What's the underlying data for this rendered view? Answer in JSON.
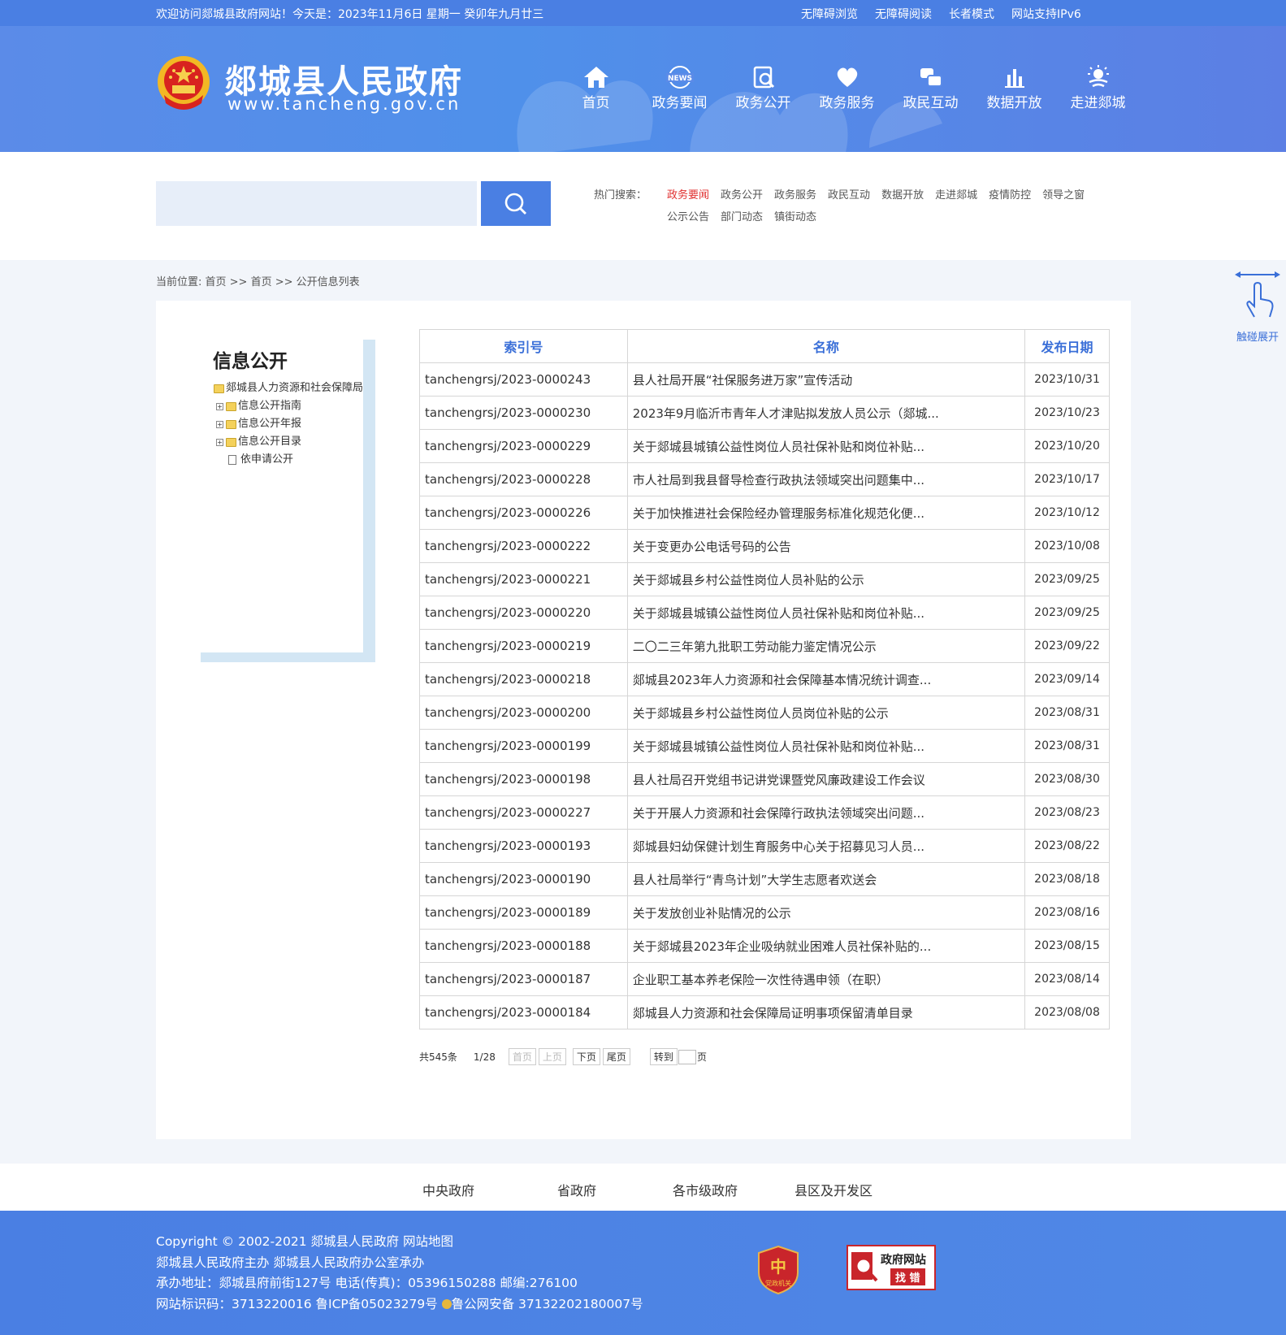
{
  "topbar": {
    "welcome": "欢迎访问郯城县政府网站！今天是：2023年11月6日  星期一  癸卯年九月廿三",
    "links": [
      "无障碍浏览",
      "无障碍阅读",
      "长者模式",
      "网站支持IPv6"
    ]
  },
  "header": {
    "title": "郯城县人民政府",
    "url": "www.tancheng.gov.cn",
    "nav": [
      {
        "label": "首页",
        "icon": "home-icon"
      },
      {
        "label": "政务要闻",
        "icon": "news-icon",
        "icon_text": "NEWS"
      },
      {
        "label": "政务公开",
        "icon": "document-search-icon"
      },
      {
        "label": "政务服务",
        "icon": "heart-hand-icon"
      },
      {
        "label": "政民互动",
        "icon": "chat-icon"
      },
      {
        "label": "数据开放",
        "icon": "bar-chart-icon"
      },
      {
        "label": "走进郯城",
        "icon": "weather-sun-icon"
      }
    ]
  },
  "search": {
    "placeholder": "",
    "hot_label": "热门搜索：",
    "hot_words": [
      "政务要闻",
      "政务公开",
      "政务服务",
      "政民互动",
      "数据开放",
      "走进郯城",
      "疫情防控",
      "领导之窗",
      "公示公告",
      "部门动态",
      "镇街动态"
    ]
  },
  "breadcrumb": {
    "prefix": "当前位置: ",
    "items": [
      "首页",
      "首页",
      "公开信息列表"
    ],
    "separator": " >> "
  },
  "sidebar": {
    "title": "信息公开",
    "root": "郯城县人力资源和社会保障局",
    "children": [
      "信息公开指南",
      "信息公开年报",
      "信息公开目录"
    ],
    "leaf": "依申请公开"
  },
  "table": {
    "headers": [
      "索引号",
      "名称",
      "发布日期"
    ],
    "rows": [
      [
        "tanchengrsj/2023-0000243",
        "县人社局开展“社保服务进万家”宣传活动",
        "2023/10/31"
      ],
      [
        "tanchengrsj/2023-0000230",
        "2023年9月临沂市青年人才津贴拟发放人员公示（郯城...",
        "2023/10/23"
      ],
      [
        "tanchengrsj/2023-0000229",
        "关于郯城县城镇公益性岗位人员社保补贴和岗位补贴...",
        "2023/10/20"
      ],
      [
        "tanchengrsj/2023-0000228",
        "市人社局到我县督导检查行政执法领域突出问题集中...",
        "2023/10/17"
      ],
      [
        "tanchengrsj/2023-0000226",
        "关于加快推进社会保险经办管理服务标准化规范化便...",
        "2023/10/12"
      ],
      [
        "tanchengrsj/2023-0000222",
        "关于变更办公电话号码的公告",
        "2023/10/08"
      ],
      [
        "tanchengrsj/2023-0000221",
        "关于郯城县乡村公益性岗位人员补贴的公示",
        "2023/09/25"
      ],
      [
        "tanchengrsj/2023-0000220",
        "关于郯城县城镇公益性岗位人员社保补贴和岗位补贴...",
        "2023/09/25"
      ],
      [
        "tanchengrsj/2023-0000219",
        "二〇二三年第九批职工劳动能力鉴定情况公示",
        "2023/09/22"
      ],
      [
        "tanchengrsj/2023-0000218",
        "郯城县2023年人力资源和社会保障基本情况统计调查...",
        "2023/09/14"
      ],
      [
        "tanchengrsj/2023-0000200",
        "关于郯城县乡村公益性岗位人员岗位补贴的公示",
        "2023/08/31"
      ],
      [
        "tanchengrsj/2023-0000199",
        "关于郯城县城镇公益性岗位人员社保补贴和岗位补贴...",
        "2023/08/31"
      ],
      [
        "tanchengrsj/2023-0000198",
        "县人社局召开党组书记讲党课暨党风廉政建设工作会议",
        "2023/08/30"
      ],
      [
        "tanchengrsj/2023-0000227",
        "关于开展人力资源和社会保障行政执法领域突出问题...",
        "2023/08/23"
      ],
      [
        "tanchengrsj/2023-0000193",
        "郯城县妇幼保健计划生育服务中心关于招募见习人员...",
        "2023/08/22"
      ],
      [
        "tanchengrsj/2023-0000190",
        "县人社局举行“青鸟计划”大学生志愿者欢送会",
        "2023/08/18"
      ],
      [
        "tanchengrsj/2023-0000189",
        "关于发放创业补贴情况的公示",
        "2023/08/16"
      ],
      [
        "tanchengrsj/2023-0000188",
        "关于郯城县2023年企业吸纳就业困难人员社保补贴的...",
        "2023/08/15"
      ],
      [
        "tanchengrsj/2023-0000187",
        "企业职工基本养老保险一次性待遇申领（在职）",
        "2023/08/14"
      ],
      [
        "tanchengrsj/2023-0000184",
        "郯城县人力资源和社会保障局证明事项保留清单目录",
        "2023/08/08"
      ]
    ]
  },
  "pager": {
    "total": "共545条",
    "page": "1/28",
    "first": "首页",
    "prev": "上页",
    "next": "下页",
    "last": "尾页",
    "goto": "转到",
    "page_unit": "页"
  },
  "touch": {
    "label": "触碰展开"
  },
  "footer_links": [
    "中央政府",
    "省政府",
    "各市级政府",
    "县区及开发区"
  ],
  "footer": {
    "copyright": "Copyright © 2002-2021 郯城县人民政府",
    "sitemap": "网站地图",
    "sponsor": "郯城县人民政府主办 郯城县人民政府办公室承办",
    "address": "承办地址：郯城县府前街127号  电话(传真)：05396150288  邮编:276100",
    "ids": "网站标识码：3713220016  鲁ICP备05023279号",
    "police": "鲁公网安备 37132202180007号",
    "badge1_text": "党政机关",
    "badge2_line1": "政府网站",
    "badge2_line2": "找 错"
  },
  "colors": {
    "brand": "#4a7fe3",
    "hot_active": "#e03030",
    "header_link": "#3a6fd8"
  }
}
